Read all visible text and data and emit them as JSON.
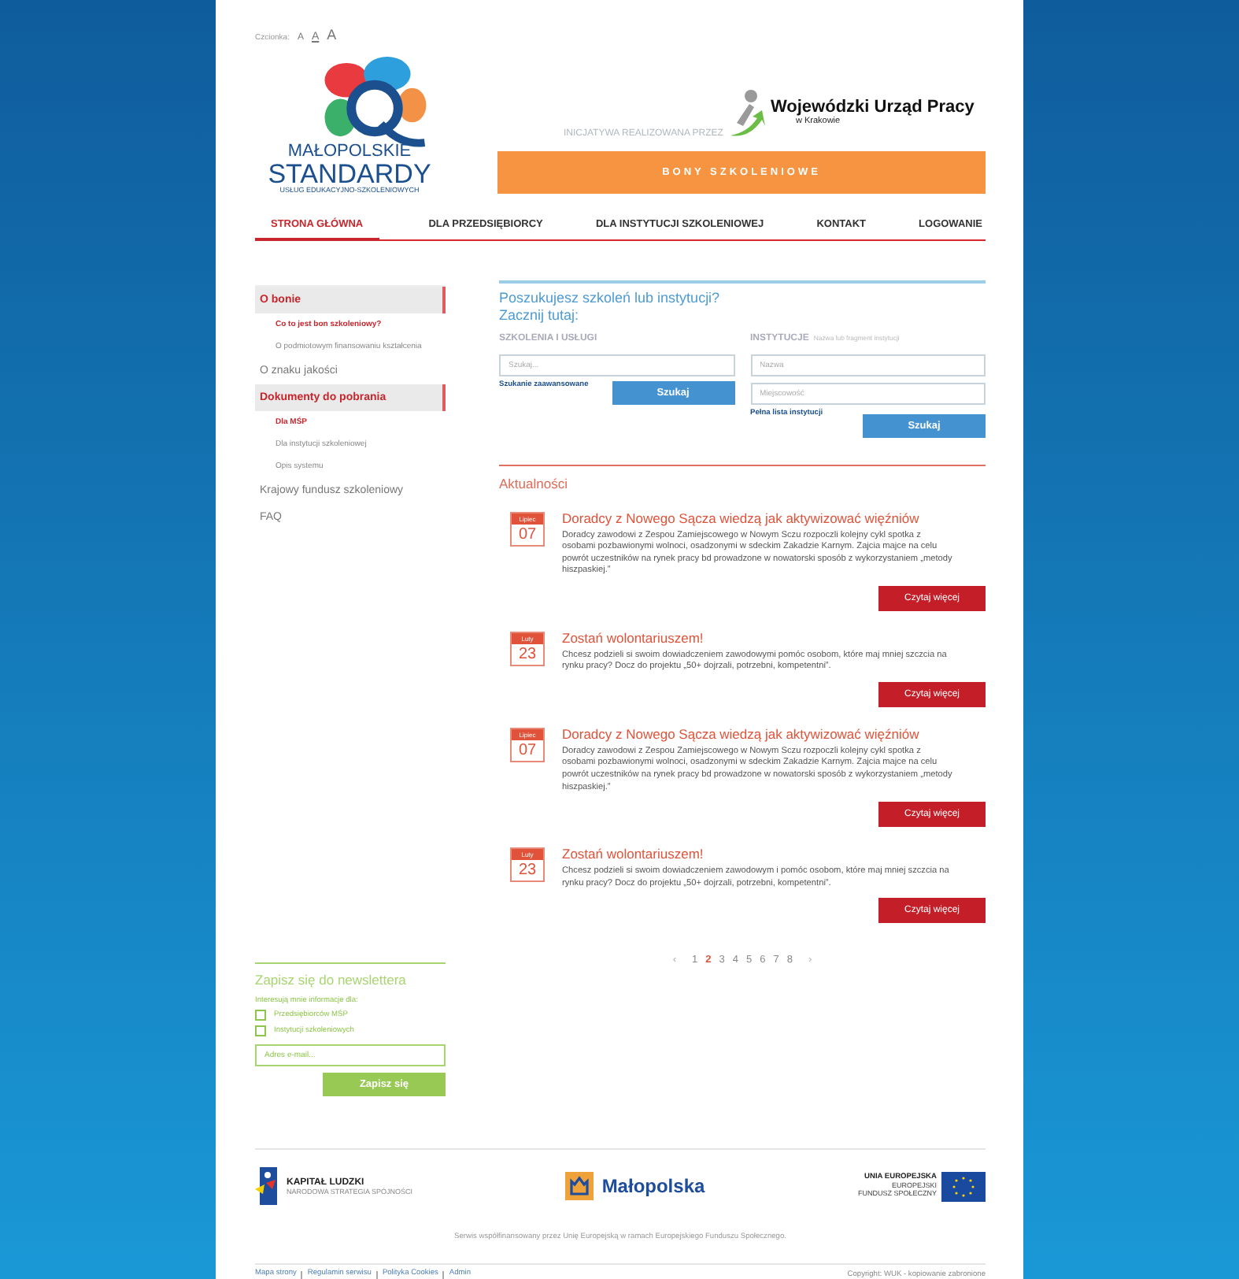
{
  "font_size": {
    "label": "Czcionka:",
    "options": [
      {
        "label": "A",
        "selected": false
      },
      {
        "label": "A",
        "selected": true
      },
      {
        "label": "A",
        "selected": false
      }
    ]
  },
  "logo": {
    "line_1": "MAŁOPOLSKIE",
    "line_2": "STANDARDY",
    "line_3": "USŁUG EDUKACYJNO-SZKOLENIOWYCH"
  },
  "initiative": {
    "label": "INICJATYWA REALIZOWANA PRZEZ",
    "partner_name": "Wojewódzki Urząd Pracy",
    "partner_city": "w Krakowie"
  },
  "banner": "BONY SZKOLENIOWE",
  "nav": [
    {
      "label": "STRONA GŁÓWNA",
      "selected": true
    },
    {
      "label": "DLA PRZEDSIĘBIORCY",
      "selected": false
    },
    {
      "label": "DLA INSTYTUCJI SZKOLENIOWEJ",
      "selected": false
    },
    {
      "label": "KONTAKT",
      "selected": false
    },
    {
      "label": "LOGOWANIE",
      "selected": false
    }
  ],
  "sidebar": {
    "items": [
      {
        "label": "O bonie",
        "selected": true,
        "children": [
          {
            "label": "Co to jest bon szkoleniowy?",
            "selected": true
          },
          {
            "label": "O podmiotowym finansowaniu kształcenia",
            "selected": false
          }
        ]
      },
      {
        "label": "O znaku jakości",
        "selected": false
      },
      {
        "label": "Dokumenty do pobrania",
        "selected": true,
        "children": [
          {
            "label": "Dla MŚP",
            "selected": true
          },
          {
            "label": "Dla instytucji szkoleniowej",
            "selected": false
          },
          {
            "label": "Opis systemu",
            "selected": false
          }
        ]
      },
      {
        "label": "Krajowy fundusz szkoleniowy",
        "selected": false
      },
      {
        "label": "FAQ",
        "selected": false
      }
    ]
  },
  "newsletter": {
    "title": "Zapisz się do newslettera",
    "label": "Interesują mnie informacje dla:",
    "options": [
      {
        "label": "Przedsiębiorców MŚP",
        "checked": false
      },
      {
        "label": "Instytucji szkoleniowych",
        "checked": false
      }
    ],
    "email_placeholder": "Adres e-mail...",
    "button": "Zapisz się"
  },
  "search": {
    "title_line_1": "Poszukujesz szkoleń lub instytucji?",
    "title_line_2": "Zacznij tutaj:",
    "trainings": {
      "heading": "SZKOLENIA I USŁUGI",
      "placeholder": "Szukaj...",
      "link": "Szukanie zaawansowane",
      "button": "Szukaj"
    },
    "institutions": {
      "heading": "INSTYTUCJE",
      "hint": "Nazwa lub fragment instytucji",
      "name_placeholder": "Nazwa",
      "city_placeholder": "Miejscowość",
      "link": "Pełna lista instytucji",
      "button": "Szukaj"
    }
  },
  "news": {
    "title": "Aktualności",
    "items": [
      {
        "month": "Lipiec",
        "day": "07",
        "title": "Doradcy z Nowego Sącza wiedzą jak aktywizować więźniów",
        "body": "Doradcy zawodowi z Zespou Zamiejscowego w Nowym Sczu rozpoczli kolejny cykl spotka z osobami pozbawionymi wolnoci, osadzonymi w sdeckim Zakadzie Karnym. Zajcia majce na celu powrót uczestników na rynek pracy bd prowadzone w nowatorski sposób z wykorzystaniem „metody hiszpaskiej.”",
        "button": "Czytaj więcej"
      },
      {
        "month": "Luty",
        "day": "23",
        "title": "Zostań wolontariuszem!",
        "body": "Chcesz podzieli si swoim dowiadczeniem zawodowymi pomóc osobom, które maj mniej szczcia na rynku pracy? Docz do projektu „50+ dojrzali, potrzebni, kompetentni”.",
        "button": "Czytaj więcej"
      },
      {
        "month": "Lipiec",
        "day": "07",
        "title": "Doradcy z Nowego Sącza wiedzą jak aktywizować więźniów",
        "body": "Doradcy zawodowi z Zespou Zamiejscowego w Nowym Sczu rozpoczli kolejny cykl spotka z osobami pozbawionymi wolnoci, osadzonymi w sdeckim Zakadzie Karnym. Zajcia majce na celu powrót uczestników na rynek pracy bd prowadzone w nowatorski sposób z wykorzystaniem „metody hiszpaskiej.”",
        "button": "Czytaj więcej"
      },
      {
        "month": "Luty",
        "day": "23",
        "title": "Zostań wolontariuszem!",
        "body": "Chcesz podzieli si swoim dowiadczeniem zawodowym i pomóc osobom, które maj mniej szczcia na rynku pracy? Docz do projektu „50+ dojrzali, potrzebni, kompetentni”.",
        "button": "Czytaj więcej"
      }
    ]
  },
  "pagination": {
    "prev": "‹",
    "next": "›",
    "pages": [
      {
        "label": "1",
        "selected": false
      },
      {
        "label": "2",
        "selected": true
      },
      {
        "label": "3",
        "selected": false
      },
      {
        "label": "4",
        "selected": false
      },
      {
        "label": "5",
        "selected": false
      },
      {
        "label": "6",
        "selected": false
      },
      {
        "label": "7",
        "selected": false
      },
      {
        "label": "8",
        "selected": false
      }
    ]
  },
  "footer": {
    "kl_name": "KAPITAŁ LUDZKI",
    "kl_sub": "NARODOWA STRATEGIA SPÓJNOŚCI",
    "region": "Małopolska",
    "eu_line_1": "UNIA EUROPEJSKA",
    "eu_line_2": "EUROPEJSKI",
    "eu_line_3": "FUNDUSZ SPOŁECZNY",
    "note": "Serwis współfinansowany przez Unię Europejską w ramach Europejskiego Funduszu Społecznego.",
    "links": [
      "Mapa strony",
      "Regulamin serwisu",
      "Polityka Cookies",
      "Admin"
    ],
    "copyright": "Copyright: WUK - kopiowanie zabronione"
  }
}
